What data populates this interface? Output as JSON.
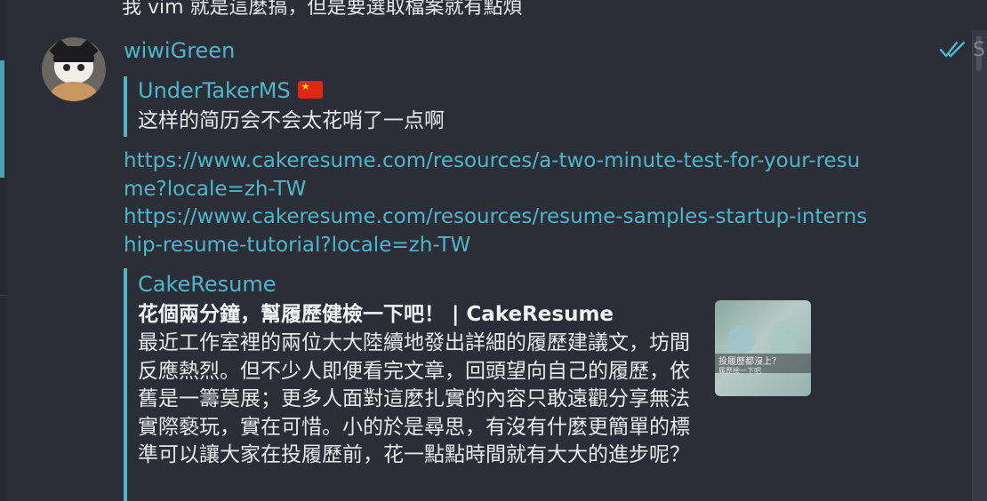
{
  "previous_message": "我 vim 就是這麼搞，但是要選取檔案就有點煩",
  "message": {
    "author": "wiwiGreen",
    "status_icon": "double-check-icon",
    "time_partial": "S",
    "reply": {
      "name": "UnderTakerMS",
      "flag_icon": "china-flag-icon",
      "text": "这样的简历会不会太花哨了一点啊"
    },
    "links": [
      "https://www.cakeresume.com/resources/a-two-minute-test-for-your-resume?locale=zh-TW",
      "https://www.cakeresume.com/resources/resume-samples-startup-internship-resume-tutorial?locale=zh-TW"
    ],
    "link_preview": {
      "site": "CakeResume",
      "title": "花個兩分鐘，幫履歷健檢一下吧！ | CakeResume",
      "description": "最近工作室裡的兩位大大陸續地發出詳細的履歷建議文，坊間反應熱烈。但不少人即便看完文章，回頭望向自己的履歷，依舊是一籌莫展；更多人面對這麼扎實的內容只敢遠觀分享無法實際褻玩，實在可惜。小的於是尋思，有沒有什麼更簡單的標準可以讓大家在投履歷前，花一點點時間就有大大的進步呢？",
      "image_text_1": "投履歷都沒上？",
      "image_text_2": "履歷檢一下吧"
    }
  },
  "colors": {
    "background": "#2b2e37",
    "accent": "#4fb6c9",
    "text": "#e6e8ea"
  }
}
